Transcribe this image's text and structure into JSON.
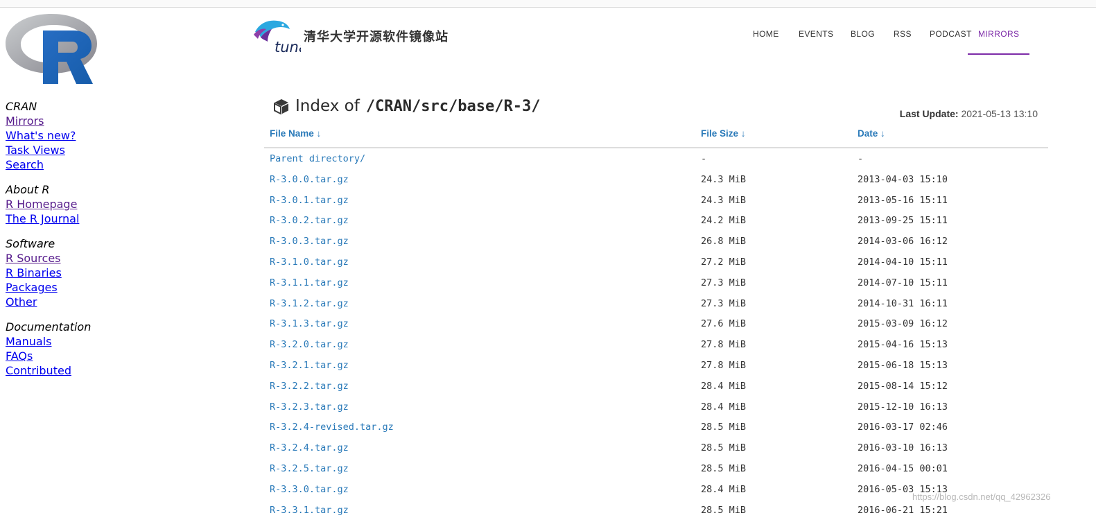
{
  "r_sidebar": {
    "sections": [
      {
        "title": "CRAN",
        "links": [
          {
            "label": "Mirrors",
            "visited": true
          },
          {
            "label": "What's new?",
            "visited": false
          },
          {
            "label": "Task Views",
            "visited": false
          },
          {
            "label": "Search",
            "visited": false
          }
        ]
      },
      {
        "title": "About R",
        "links": [
          {
            "label": "R Homepage",
            "visited": true
          },
          {
            "label": "The R Journal",
            "visited": false
          }
        ]
      },
      {
        "title": "Software",
        "links": [
          {
            "label": "R Sources",
            "visited": true
          },
          {
            "label": "R Binaries",
            "visited": false
          },
          {
            "label": "Packages",
            "visited": false
          },
          {
            "label": "Other",
            "visited": false
          }
        ]
      },
      {
        "title": "Documentation",
        "links": [
          {
            "label": "Manuals",
            "visited": false
          },
          {
            "label": "FAQs",
            "visited": false
          },
          {
            "label": "Contributed",
            "visited": false
          }
        ]
      }
    ]
  },
  "header": {
    "site_title": "清华大学开源软件镜像站",
    "logo_text": "tuna",
    "nav": [
      {
        "label": "HOME",
        "active": false
      },
      {
        "label": "EVENTS",
        "active": false
      },
      {
        "label": "BLOG",
        "active": false
      },
      {
        "label": "RSS",
        "active": false
      },
      {
        "label": "PODCAST",
        "active": false
      },
      {
        "label": "MIRRORS",
        "active": true
      }
    ]
  },
  "index": {
    "label": "Index of",
    "path": "/CRAN/src/base/R-3/",
    "last_update_label": "Last Update:",
    "last_update_value": "2021-05-13 13:10"
  },
  "table": {
    "headers": {
      "name": "File Name ↓",
      "size": "File Size ↓",
      "date": "Date ↓"
    },
    "rows": [
      {
        "name": "Parent directory/",
        "size": "-",
        "date": "-"
      },
      {
        "name": "R-3.0.0.tar.gz",
        "size": "24.3 MiB",
        "date": "2013-04-03 15:10"
      },
      {
        "name": "R-3.0.1.tar.gz",
        "size": "24.3 MiB",
        "date": "2013-05-16 15:11"
      },
      {
        "name": "R-3.0.2.tar.gz",
        "size": "24.2 MiB",
        "date": "2013-09-25 15:11"
      },
      {
        "name": "R-3.0.3.tar.gz",
        "size": "26.8 MiB",
        "date": "2014-03-06 16:12"
      },
      {
        "name": "R-3.1.0.tar.gz",
        "size": "27.2 MiB",
        "date": "2014-04-10 15:11"
      },
      {
        "name": "R-3.1.1.tar.gz",
        "size": "27.3 MiB",
        "date": "2014-07-10 15:11"
      },
      {
        "name": "R-3.1.2.tar.gz",
        "size": "27.3 MiB",
        "date": "2014-10-31 16:11"
      },
      {
        "name": "R-3.1.3.tar.gz",
        "size": "27.6 MiB",
        "date": "2015-03-09 16:12"
      },
      {
        "name": "R-3.2.0.tar.gz",
        "size": "27.8 MiB",
        "date": "2015-04-16 15:13"
      },
      {
        "name": "R-3.2.1.tar.gz",
        "size": "27.8 MiB",
        "date": "2015-06-18 15:13"
      },
      {
        "name": "R-3.2.2.tar.gz",
        "size": "28.4 MiB",
        "date": "2015-08-14 15:12"
      },
      {
        "name": "R-3.2.3.tar.gz",
        "size": "28.4 MiB",
        "date": "2015-12-10 16:13"
      },
      {
        "name": "R-3.2.4-revised.tar.gz",
        "size": "28.5 MiB",
        "date": "2016-03-17 02:46"
      },
      {
        "name": "R-3.2.4.tar.gz",
        "size": "28.5 MiB",
        "date": "2016-03-10 16:13"
      },
      {
        "name": "R-3.2.5.tar.gz",
        "size": "28.5 MiB",
        "date": "2016-04-15 00:01"
      },
      {
        "name": "R-3.3.0.tar.gz",
        "size": "28.4 MiB",
        "date": "2016-05-03 15:13"
      },
      {
        "name": "R-3.3.1.tar.gz",
        "size": "28.5 MiB",
        "date": "2016-06-21 15:21"
      }
    ]
  },
  "watermark": "https://blog.csdn.net/qq_42962326"
}
